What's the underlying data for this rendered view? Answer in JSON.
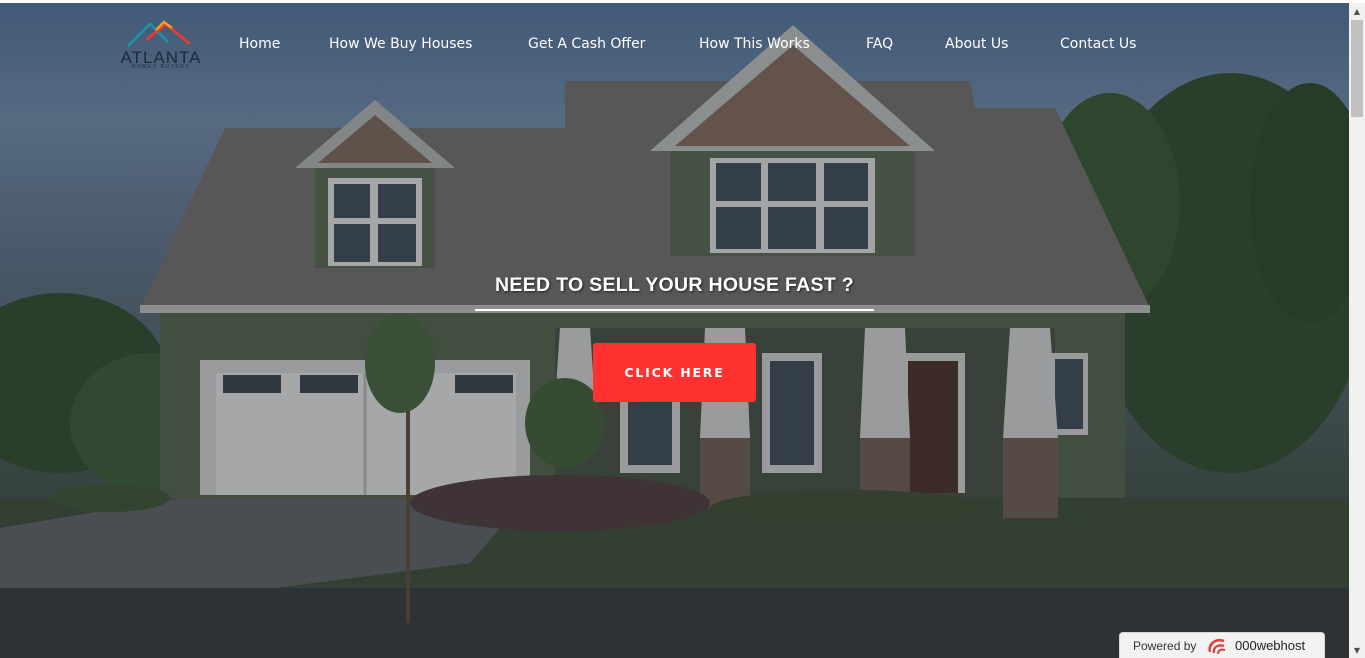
{
  "logo": {
    "word": "ATLANTA",
    "sub": "HOMES BUYERS"
  },
  "nav": {
    "items": [
      {
        "label": "Home"
      },
      {
        "label": "How We Buy Houses"
      },
      {
        "label": "Get A Cash Offer"
      },
      {
        "label": "How This Works"
      },
      {
        "label": "FAQ"
      },
      {
        "label": "About Us"
      },
      {
        "label": "Contact Us"
      }
    ]
  },
  "hero": {
    "headline": "NEED TO SELL YOUR HOUSE FAST ?",
    "cta_label": "CLICK HERE"
  },
  "badge": {
    "label": "Powered by",
    "brand": "000webhost"
  },
  "colors": {
    "cta": "#ff3131",
    "nav_text": "#ffffff",
    "logo_text": "#1f2a3a"
  }
}
